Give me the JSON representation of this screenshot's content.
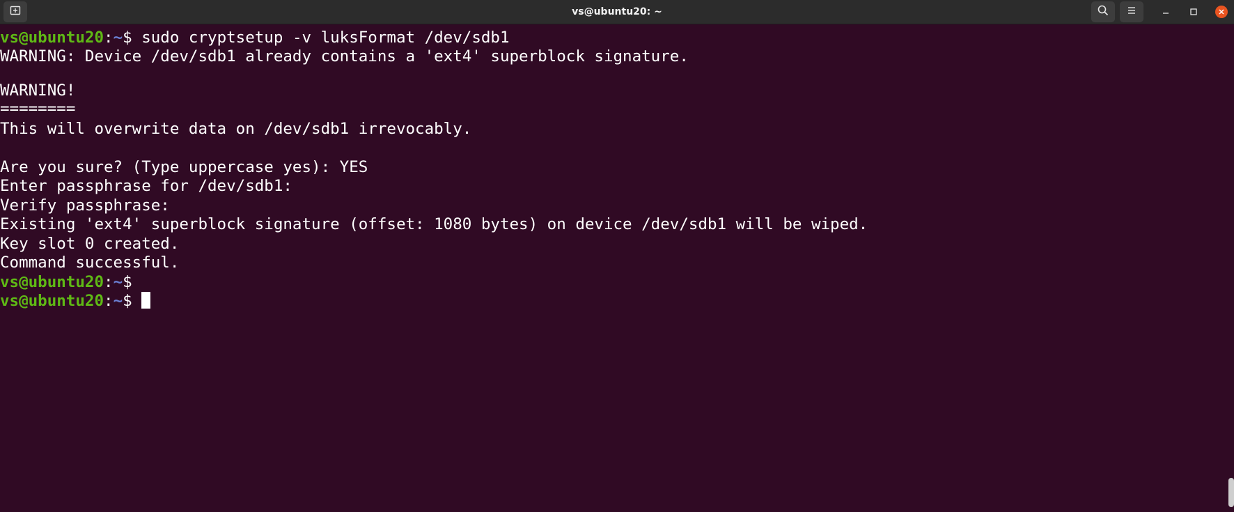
{
  "window": {
    "title": "vs@ubuntu20: ~",
    "new_tab_icon": "new-tab-icon",
    "search_icon": "search-icon",
    "menu_icon": "hamburger-menu-icon",
    "minimize_icon": "minimize-icon",
    "maximize_icon": "maximize-icon",
    "close_icon": "close-icon"
  },
  "colors": {
    "background": "#300a24",
    "titlebar": "#2c2c2c",
    "prompt_user": "#5fb915",
    "prompt_path": "#6a7fd2",
    "text": "#ffffff",
    "close_button": "#e95420"
  },
  "prompt": {
    "user_host": "vs@ubuntu20",
    "colon": ":",
    "path": "~",
    "dollar": "$"
  },
  "terminal": {
    "command": " sudo cryptsetup -v luksFormat /dev/sdb1",
    "output": [
      "WARNING: Device /dev/sdb1 already contains a 'ext4' superblock signature.",
      "",
      "WARNING!",
      "========",
      "This will overwrite data on /dev/sdb1 irrevocably.",
      "",
      "Are you sure? (Type uppercase yes): YES",
      "Enter passphrase for /dev/sdb1:",
      "Verify passphrase:",
      "Existing 'ext4' superblock signature (offset: 1080 bytes) on device /dev/sdb1 will be wiped.",
      "Key slot 0 created.",
      "Command successful."
    ]
  }
}
